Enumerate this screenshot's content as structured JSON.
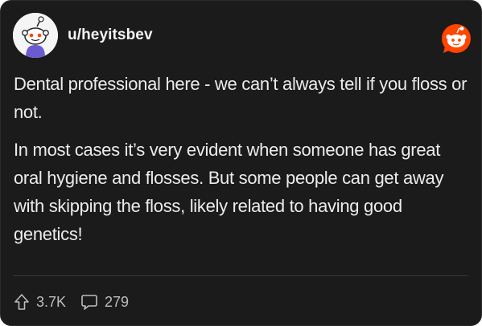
{
  "post": {
    "username": "u/heyitsbev",
    "paragraphs": [
      "Dental professional here - we can’t always tell if you floss or not.",
      "In most cases it’s very evident when someone has great oral hygiene and flosses. But some people can get away with skipping the floss, likely related to having good genetics!"
    ]
  },
  "stats": {
    "upvotes": "3.7K",
    "comments": "279"
  },
  "icons": {
    "avatar": "snoo-avatar",
    "brand": "reddit-logo-icon",
    "upvote": "upvote-arrow-icon",
    "comment": "comment-bubble-icon"
  },
  "colors": {
    "card_background": "#1b1b1c",
    "reddit_orange": "#ff4500",
    "text": "#ececec",
    "muted": "#bdbdbd"
  }
}
